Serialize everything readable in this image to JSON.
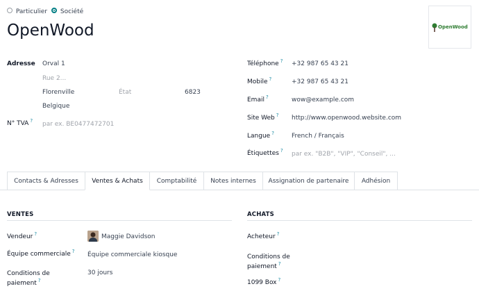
{
  "partner_type": {
    "option_individual": "Particulier",
    "option_company": "Société",
    "selected": "Société"
  },
  "name": "OpenWood",
  "logo_text": "OpenWood",
  "address": {
    "label": "Adresse",
    "street": "Orval 1",
    "street2_placeholder": "Rue 2...",
    "city": "Florenville",
    "state_placeholder": "État",
    "zip": "6823",
    "country": "Belgique"
  },
  "vat": {
    "label": "N° TVA",
    "placeholder": "par ex. BE0477472701"
  },
  "contact": {
    "phone_label": "Téléphone",
    "phone": "+32 987 65 43 21",
    "mobile_label": "Mobile",
    "mobile": "+32 987 65 43 21",
    "email_label": "Email",
    "email": "wow@example.com",
    "website_label": "Site Web",
    "website": "http://www.openwood.website.com",
    "language_label": "Langue",
    "language": "French / Français",
    "tags_label": "Étiquettes",
    "tags_placeholder": "par ex. \"B2B\", \"VIP\", \"Conseil\", ..."
  },
  "tabs": [
    {
      "label": "Contacts & Adresses",
      "active": false
    },
    {
      "label": "Ventes & Achats",
      "active": true
    },
    {
      "label": "Comptabilité",
      "active": false
    },
    {
      "label": "Notes internes",
      "active": false
    },
    {
      "label": "Assignation de partenaire",
      "active": false
    },
    {
      "label": "Adhésion",
      "active": false
    }
  ],
  "sales": {
    "title": "VENTES",
    "salesperson_label": "Vendeur",
    "salesperson": "Maggie Davidson",
    "team_label": "Équipe commerciale",
    "team": "Équipe commerciale kiosque",
    "payment_terms_label_1": "Conditions de",
    "payment_terms_label_2": "paiement",
    "payment_terms": "30 jours"
  },
  "purchase": {
    "title": "ACHATS",
    "buyer_label": "Acheteur",
    "payment_terms_label_1": "Conditions de",
    "payment_terms_label_2": "paiement",
    "box_1099_label": "1099 Box"
  },
  "help_marker": "?",
  "colors": {
    "accent": "#017e84",
    "help": "#1a8aa3",
    "logo_green": "#2f7d32"
  }
}
